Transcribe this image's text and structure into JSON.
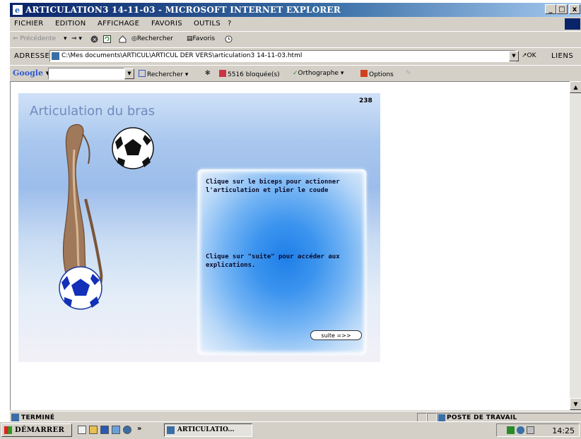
{
  "window": {
    "title": "ARTICULATION3 14-11-03 - MICROSOFT INTERNET EXPLORER",
    "controls": [
      "_",
      "□",
      "x"
    ]
  },
  "menu": [
    "FICHIER",
    "EDITION",
    "AFFICHAGE",
    "FAVORIS",
    "OUTILS",
    "?"
  ],
  "toolbar": {
    "back": "Précédente",
    "search": "Rechercher",
    "favorites": "Favoris"
  },
  "address": {
    "label": "ADRESSE",
    "value": "C:\\Mes documents\\ARTICUL\\ARTICUL DER VERS\\articulation3 14-11-03.html",
    "go": "OK",
    "links": "LIENS"
  },
  "googlebar": {
    "logo": "Google",
    "search": "Rechercher",
    "blocked": "5516 bloquée(s)",
    "spell": "Orthographe",
    "options": "Options"
  },
  "page": {
    "title": "Articulation du bras",
    "page_number": "238",
    "instruction_1": "Clique sur le biceps pour actionner l'articulation et plier le coude",
    "instruction_2": "Clique sur \"suite\" pour accéder aux explications.",
    "next_button": "suite =>>"
  },
  "status": {
    "text": "TERMINÉ",
    "zone": "POSTE DE TRAVAIL"
  },
  "taskbar": {
    "start": "DÉMARRER",
    "overflow": "»",
    "task": "ARTICULATIO...",
    "clock": "14:25"
  },
  "colors": {
    "titlebar": "#0a246a",
    "chrome": "#d4d0c8",
    "page_title": "#6f8bbf",
    "panel_center": "#1f7fe8"
  }
}
